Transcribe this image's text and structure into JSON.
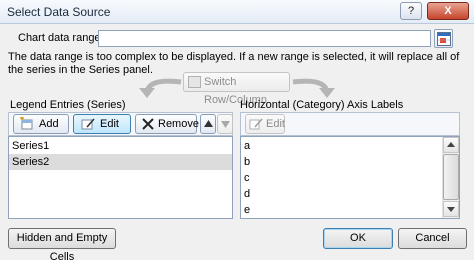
{
  "window": {
    "title": "Select Data Source",
    "help_label": "?",
    "close_label": "X"
  },
  "chart_range": {
    "label": "Chart data range:",
    "value": ""
  },
  "message": "The data range is too complex to be displayed. If a new range is selected, it will replace all of the series in the Series panel.",
  "switch_button": "Switch Row/Column",
  "legend": {
    "label": "Legend Entries (Series)",
    "add_label": "Add",
    "edit_label": "Edit",
    "remove_label": "Remove",
    "series": [
      "Series1",
      "Series2"
    ],
    "selected_index": 1
  },
  "axis": {
    "label": "Horizontal (Category) Axis Labels",
    "edit_label": "Edit",
    "items": [
      "a",
      "b",
      "c",
      "d",
      "e"
    ]
  },
  "buttons": {
    "hidden_cells": "Hidden and Empty Cells",
    "ok": "OK",
    "cancel": "Cancel"
  }
}
